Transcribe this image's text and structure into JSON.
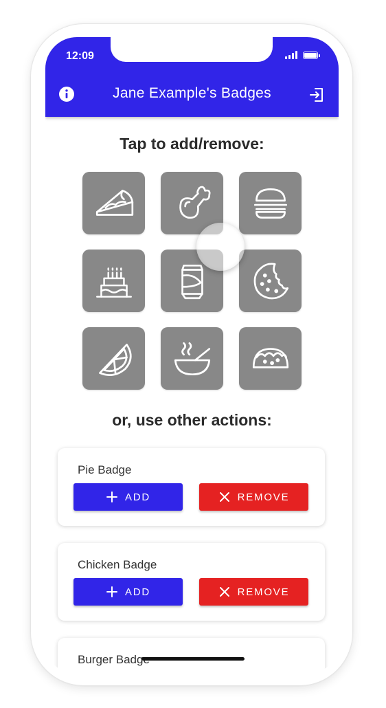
{
  "status_bar": {
    "time": "12:09"
  },
  "header": {
    "title": "Jane Example's Badges",
    "info_icon": "info-icon",
    "logout_icon": "logout-icon"
  },
  "section_tap": {
    "heading": "Tap to add/remove:"
  },
  "badges": [
    {
      "name": "pie",
      "icon": "pie-icon"
    },
    {
      "name": "chicken",
      "icon": "chicken-icon"
    },
    {
      "name": "burger",
      "icon": "burger-icon"
    },
    {
      "name": "cake",
      "icon": "cake-icon"
    },
    {
      "name": "soda",
      "icon": "soda-icon"
    },
    {
      "name": "cookie",
      "icon": "cookie-icon"
    },
    {
      "name": "lime",
      "icon": "lime-icon"
    },
    {
      "name": "soup",
      "icon": "soup-icon"
    },
    {
      "name": "taco",
      "icon": "taco-icon"
    }
  ],
  "section_actions": {
    "heading": "or, use other actions:"
  },
  "cards": [
    {
      "title": "Pie Badge",
      "add_label": "ADD",
      "remove_label": "REMOVE"
    },
    {
      "title": "Chicken Badge",
      "add_label": "ADD",
      "remove_label": "REMOVE"
    },
    {
      "title": "Burger Badge"
    }
  ],
  "colors": {
    "primary": "#3125e8",
    "danger": "#e52222",
    "tile": "#888888"
  }
}
